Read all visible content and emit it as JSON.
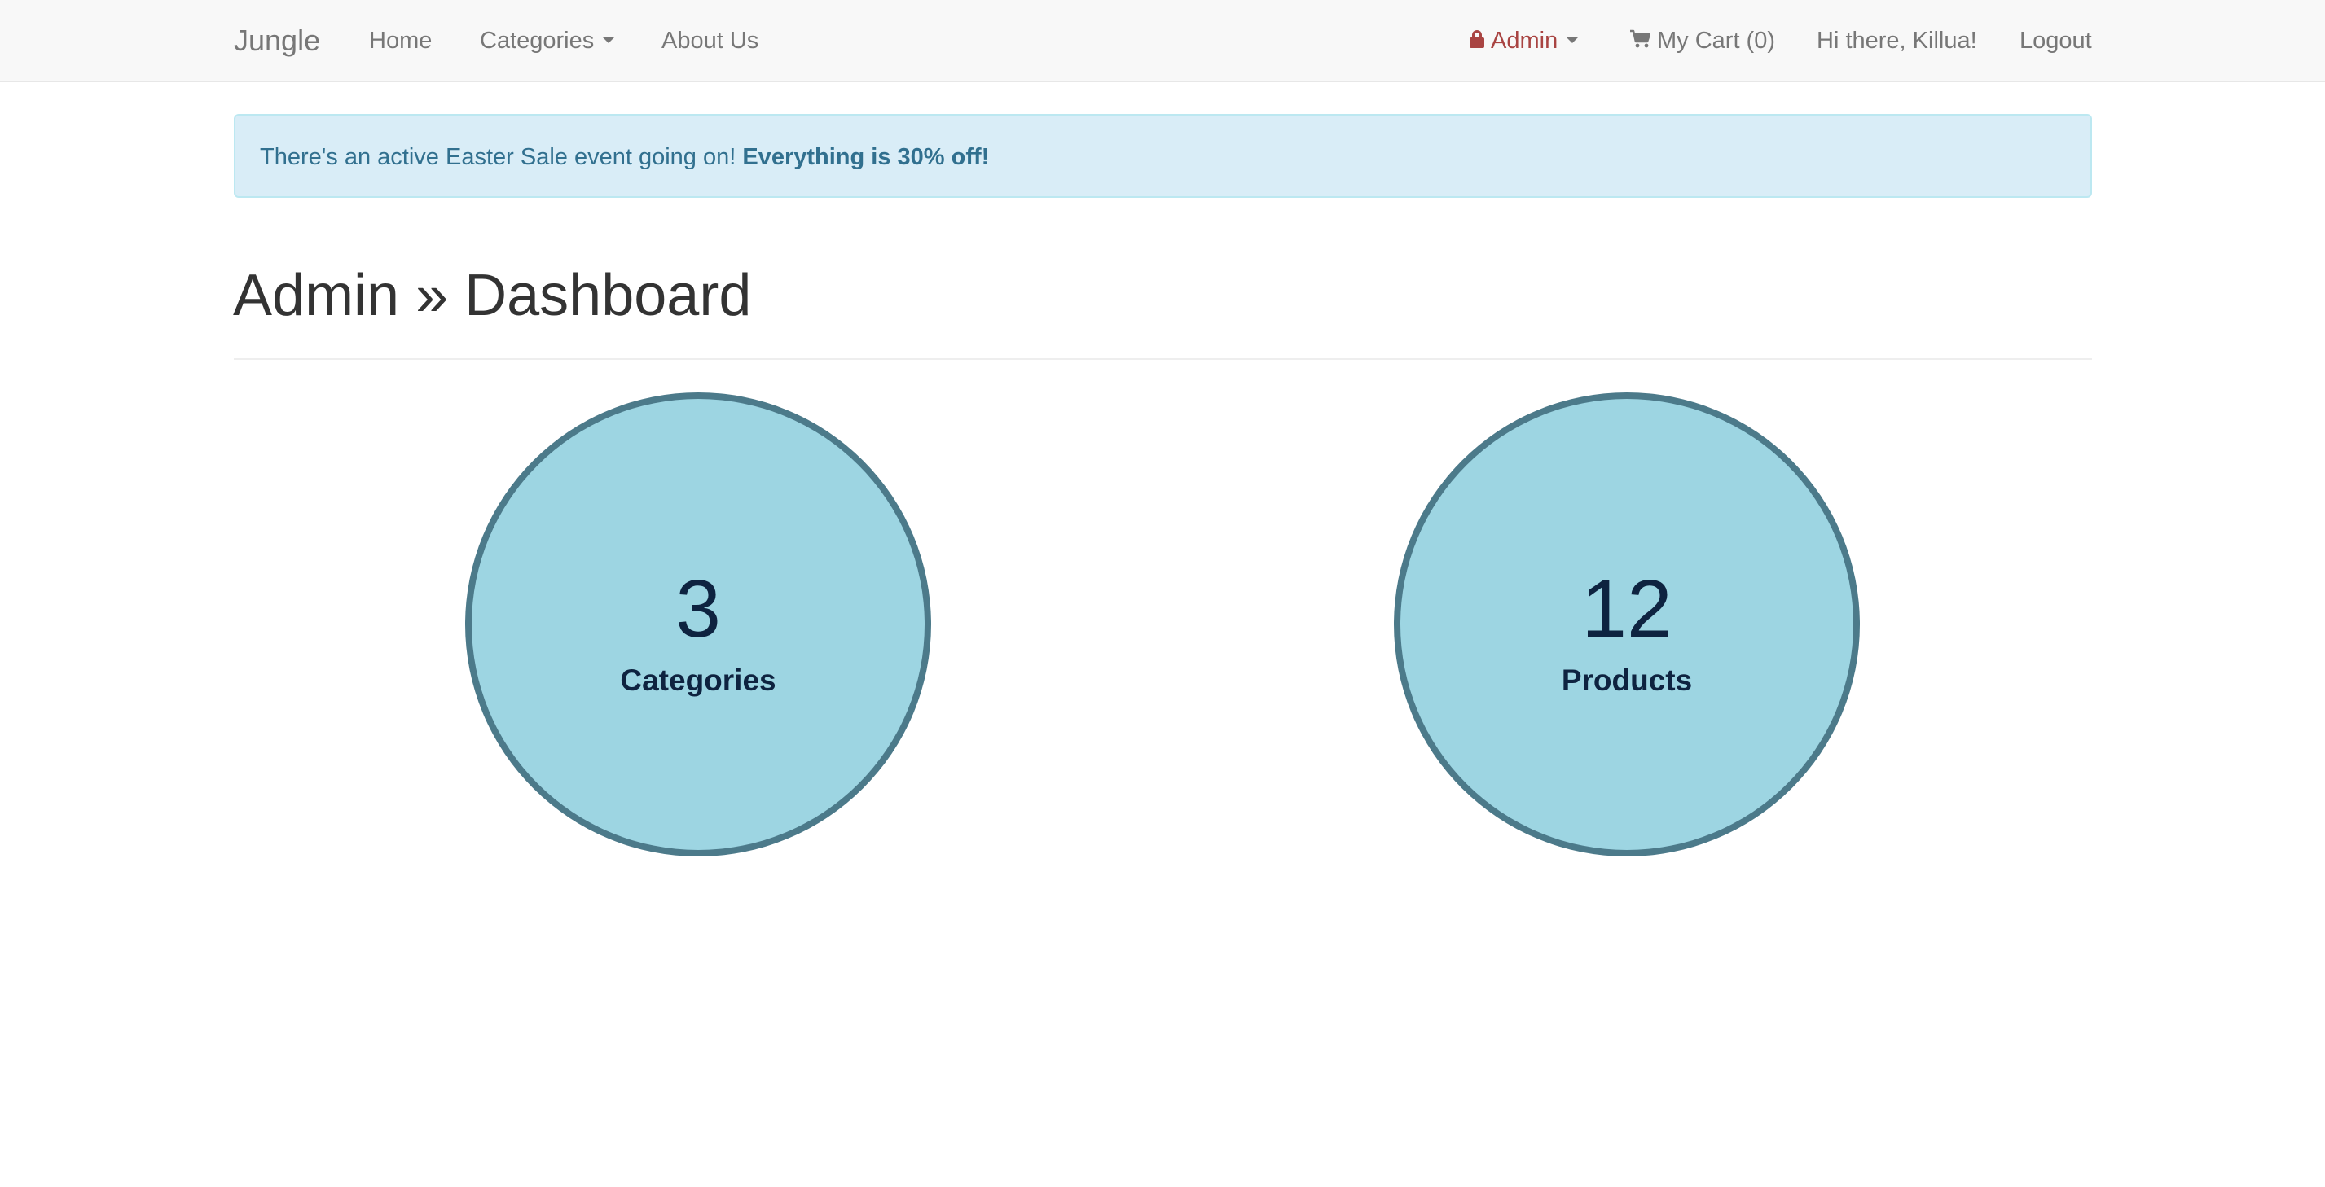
{
  "navbar": {
    "brand": "Jungle",
    "links": {
      "home": "Home",
      "categories": "Categories",
      "about": "About Us",
      "admin": "Admin",
      "cart": "My Cart (0)",
      "greeting": "Hi there, Killua!",
      "logout": "Logout"
    },
    "icons": {
      "admin": "lock-icon",
      "cart": "shopping-cart-icon",
      "dropdown": "caret-down-icon"
    },
    "colors": {
      "background": "#f8f8f8",
      "link": "#777777",
      "admin_link": "#a94442"
    }
  },
  "alert": {
    "text": "There's an active Easter Sale event going on!",
    "emphasis": "Everything is 30% off!",
    "colors": {
      "background": "#d9edf7",
      "border": "#bce8f1",
      "text": "#31708f"
    }
  },
  "page": {
    "title": "Admin » Dashboard"
  },
  "stats": [
    {
      "value": "3",
      "label": "Categories"
    },
    {
      "value": "12",
      "label": "Products"
    }
  ],
  "stat_colors": {
    "fill": "#9dd5e2",
    "border": "#4c7a8a",
    "text": "#0e2340"
  }
}
